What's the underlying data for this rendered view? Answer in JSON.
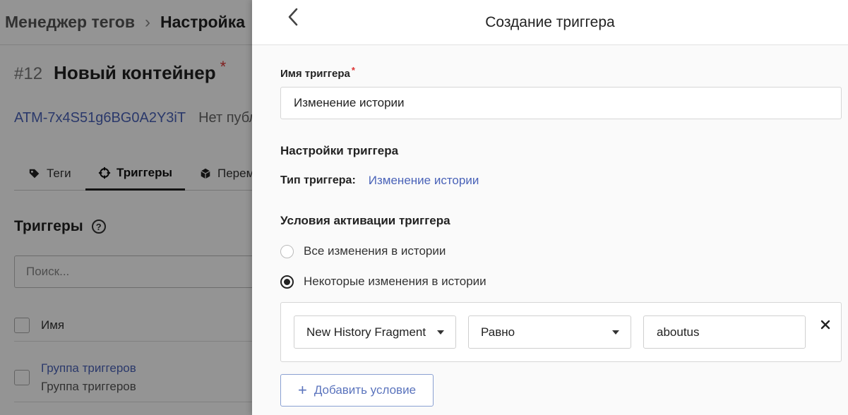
{
  "background": {
    "breadcrumb": {
      "parent": "Менеджер тегов",
      "current": "Настройка"
    },
    "container": {
      "number": "#12",
      "name": "Новый контейнер",
      "required_mark": "*",
      "id": "ATM-7x4S51g6BG0A2Y3iT",
      "publish_status": "Нет публ"
    },
    "tabs": [
      {
        "label": "Теги",
        "icon": "tags-icon"
      },
      {
        "label": "Триггеры",
        "icon": "crosshair-icon"
      },
      {
        "label": "Перем",
        "icon": "cube-icon"
      }
    ],
    "section_title": "Триггеры",
    "help_icon": "?",
    "search_placeholder": "Поиск...",
    "table_header_name": "Имя",
    "rows": [
      {
        "link": "Группа триггеров",
        "subtitle": "Группа триггеров"
      }
    ]
  },
  "drawer": {
    "title": "Создание триггера",
    "name_label": "Имя триггера",
    "name_required": "*",
    "name_value": "Изменение истории",
    "settings_title": "Настройки триггера",
    "type_key": "Тип триггера:",
    "type_value": "Изменение истории",
    "activation_title": "Условия активации триггера",
    "radio_options": [
      {
        "label": "Все изменения в истории",
        "checked": false
      },
      {
        "label": "Некоторые изменения в истории",
        "checked": true
      }
    ],
    "condition": {
      "variable": "New History Fragment",
      "operator": "Равно",
      "value": "aboutus"
    },
    "add_condition_label": "Добавить условие",
    "add_condition_icon": "+"
  },
  "colors": {
    "link": "#4a63b8",
    "add_button_border": "#8aa0d2",
    "required": "#d33"
  }
}
